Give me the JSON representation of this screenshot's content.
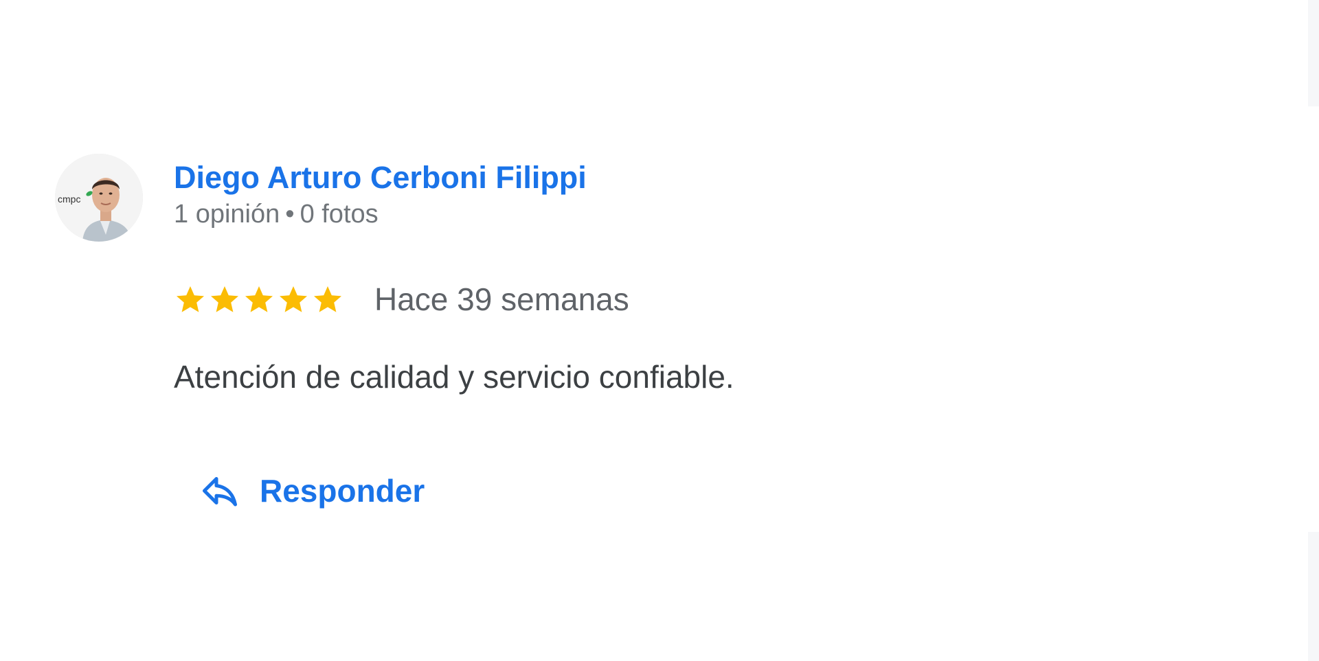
{
  "review": {
    "author": {
      "name": "Diego Arturo Cerboni Filippi",
      "reviews_count": "1 opinión",
      "separator": "•",
      "photos_count": "0 fotos",
      "avatar_logo_text": "cmpc",
      "avatar_icon": "profile-photo"
    },
    "rating": {
      "stars": 5,
      "max_stars": 5,
      "star_color": "#fbbc04"
    },
    "time_ago": "Hace 39 semanas",
    "text": "Atención de calidad y servicio confiable.",
    "reply": {
      "label": "Responder",
      "icon": "reply-icon"
    }
  },
  "colors": {
    "link": "#1a73e8",
    "meta": "#70757a",
    "body_text": "#3c4043",
    "background": "#ffffff"
  }
}
